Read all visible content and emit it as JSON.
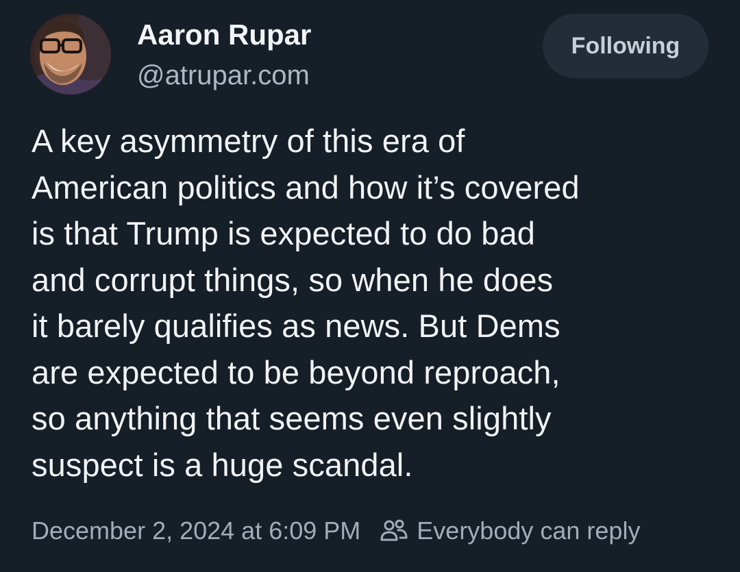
{
  "author": {
    "display_name": "Aaron Rupar",
    "handle": "@atrupar.com",
    "avatar_icon": "avatar-photo"
  },
  "follow_button": {
    "label": "Following"
  },
  "post": {
    "text": "A key asymmetry of this era of\nAmerican politics and how it’s covered\nis that Trump is expected to do bad\nand corrupt things, so when he does\nit barely qualifies as news. But Dems\nare expected to be beyond reproach,\nso anything that seems even slightly\nsuspect is a huge scandal."
  },
  "meta": {
    "timestamp": "December 2, 2024 at 6:09 PM",
    "reply_setting_icon": "people-icon",
    "reply_setting_label": "Everybody can reply"
  },
  "colors": {
    "background": "#161e27",
    "text_primary": "#f1f3f5",
    "text_secondary": "#a3adba",
    "button_background": "#232d38"
  }
}
